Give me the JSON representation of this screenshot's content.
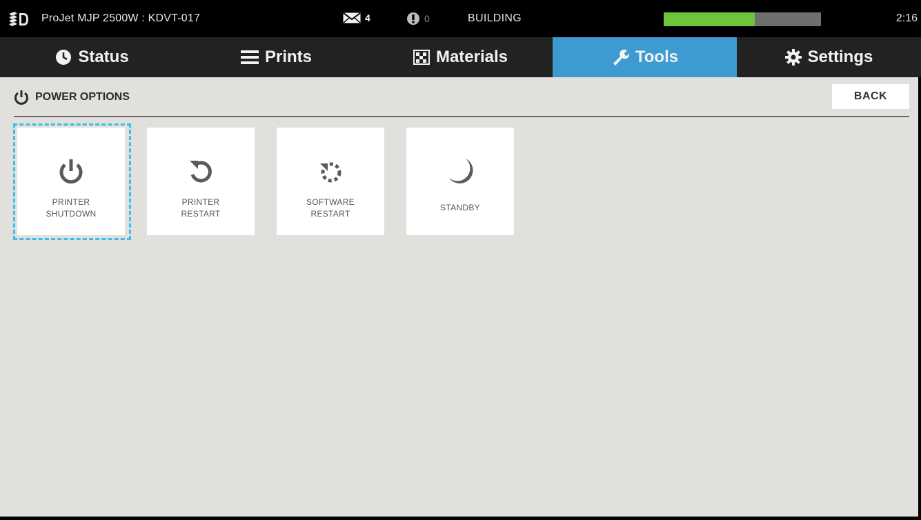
{
  "topbar": {
    "printer_name": "ProJet MJP 2500W : KDVT-017",
    "messages_count": "4",
    "alerts_count": "0",
    "state": "BUILDING",
    "progress_fraction": 0.58,
    "clock": "2:16",
    "colors": {
      "progress_fill": "#6cc63d",
      "progress_track": "#6f6f6f"
    }
  },
  "nav": {
    "tabs": [
      {
        "label": "Status",
        "icon": "clock-icon"
      },
      {
        "label": "Prints",
        "icon": "list-icon"
      },
      {
        "label": "Materials",
        "icon": "materials-grid-icon"
      },
      {
        "label": "Tools",
        "icon": "wrench-icon",
        "active": true
      },
      {
        "label": "Settings",
        "icon": "gear-icon"
      }
    ],
    "colors": {
      "active": "#3e9bd1",
      "background": "#222222"
    }
  },
  "page": {
    "title": "POWER OPTIONS",
    "back_label": "BACK"
  },
  "tiles": [
    {
      "label": "PRINTER\nSHUTDOWN",
      "icon": "power-icon",
      "focused": true
    },
    {
      "label": "PRINTER\nRESTART",
      "icon": "restart-icon"
    },
    {
      "label": "SOFTWARE\nRESTART",
      "icon": "software-restart-icon"
    },
    {
      "label": "STANDBY",
      "icon": "moon-icon"
    }
  ],
  "colors": {
    "focus_ring": "#38bdf0",
    "content_bg": "#e1e0dd"
  }
}
